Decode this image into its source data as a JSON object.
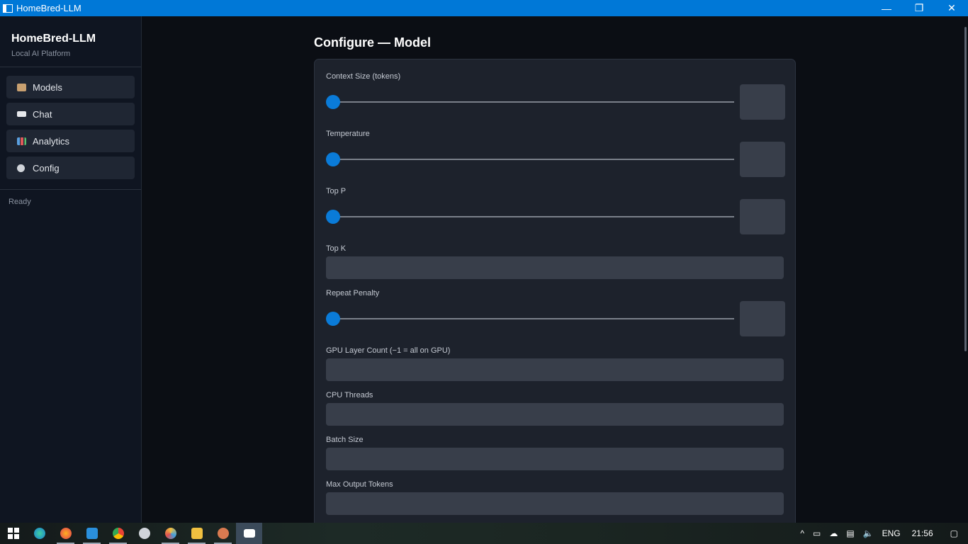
{
  "window": {
    "title": "HomeBred-LLM",
    "controls": [
      "—",
      "❐",
      "✕"
    ]
  },
  "sidebar": {
    "app_name": "HomeBred-LLM",
    "app_subtitle": "Local AI Platform",
    "items": [
      {
        "label": "Models",
        "icon": "box-icon",
        "color": "#c8a070"
      },
      {
        "label": "Chat",
        "icon": "chat-icon",
        "color": "#e6e8ec"
      },
      {
        "label": "Analytics",
        "icon": "chart-icon",
        "color": "#5aa0e0"
      },
      {
        "label": "Config",
        "icon": "gear-icon",
        "color": "#d0d4da"
      }
    ],
    "status": "Ready"
  },
  "main": {
    "title": "Configure —  Model",
    "fields": {
      "context_size": {
        "label": "Context Size (tokens)",
        "value_fraction": 0
      },
      "temperature": {
        "label": "Temperature",
        "value_fraction": 0
      },
      "top_p": {
        "label": "Top P",
        "value_fraction": 0
      },
      "top_k": {
        "label": "Top K",
        "value": ""
      },
      "repeat_penalty": {
        "label": "Repeat Penalty",
        "value_fraction": 0
      },
      "gpu_layers": {
        "label": "GPU Layer Count  (−1 = all on GPU)",
        "value": ""
      },
      "cpu_threads": {
        "label": "CPU Threads",
        "value": ""
      },
      "batch_size": {
        "label": "Batch Size",
        "value": ""
      },
      "max_output_tokens": {
        "label": "Max Output Tokens",
        "value": ""
      }
    },
    "accent_color": "#0a7bd8"
  },
  "taskbar": {
    "apps": [
      "start",
      "edge",
      "firefox",
      "vscode",
      "chrome",
      "git",
      "paint",
      "explorer",
      "claude",
      "homebred-llm"
    ],
    "tray": {
      "language": "ENG",
      "time": "21:56"
    }
  }
}
